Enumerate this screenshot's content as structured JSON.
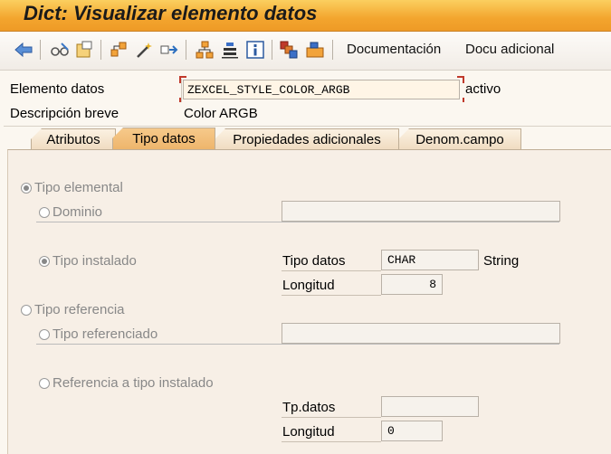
{
  "window": {
    "title": "Dict: Visualizar elemento datos"
  },
  "toolbar": {
    "icons": [
      "back-arrow-icon",
      "glasses-icon",
      "other-object-icon",
      "hierarchy-icon",
      "magic-wand-icon",
      "where-used-icon",
      "object-tree-icon",
      "align-icon",
      "info-icon",
      "multiple-objects-icon",
      "transport-icon"
    ],
    "documentation_label": "Documentación",
    "docu_adicional_label": "Docu adicional"
  },
  "header": {
    "elemento_datos_label": "Elemento datos",
    "elemento_datos_value": "ZEXCEL_STYLE_COLOR_ARGB",
    "status": "activo",
    "descripcion_label": "Descripción breve",
    "descripcion_value": "Color ARGB"
  },
  "tabs": [
    {
      "label": "Atributos"
    },
    {
      "label": "Tipo datos"
    },
    {
      "label": "Propiedades adicionales"
    },
    {
      "label": "Denom.campo"
    }
  ],
  "tipo_datos": {
    "tipo_elemental": "Tipo elemental",
    "dominio": "Dominio",
    "dominio_value": "",
    "tipo_instalado": "Tipo instalado",
    "tipo_datos_label": "Tipo datos",
    "tipo_datos_value": "CHAR",
    "tipo_datos_desc": "String",
    "longitud_label": "Longitud",
    "longitud_value": "8",
    "tipo_referencia": "Tipo referencia",
    "tipo_referenciado": "Tipo referenciado",
    "tipo_referenciado_value": "",
    "referencia_tipo_instalado": "Referencia a tipo instalado",
    "tpdatos_label": "Tp.datos",
    "tpdatos_value": "",
    "longitud2_label": "Longitud",
    "longitud2_value": "0"
  }
}
